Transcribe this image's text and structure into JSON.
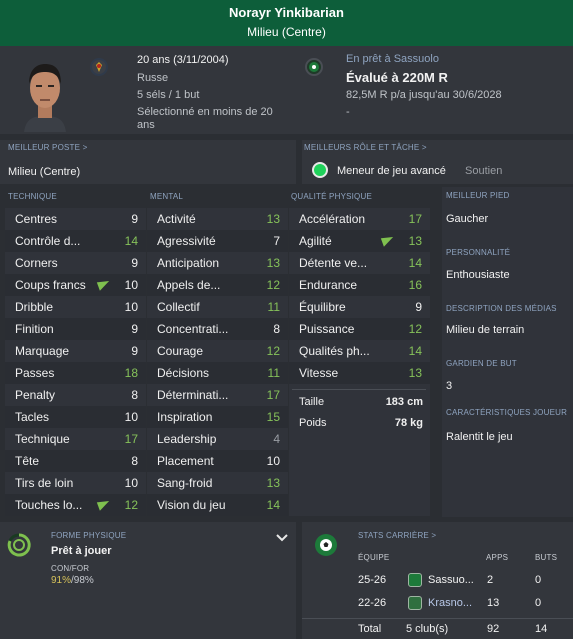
{
  "header": {
    "name": "Norayr Yinkibarian",
    "position": "Milieu (Centre)"
  },
  "profile": {
    "age": "20 ans (3/11/2004)",
    "nationality": "Russe",
    "caps": "5 séls / 1 but",
    "selected": "Sélectionné en moins de 20",
    "selected2": "ans"
  },
  "loan": {
    "status": "En prêt à Sassuolo",
    "value": "Évalué à 220M R",
    "wage": "82,5M R p/a jusqu'au 30/6/2028",
    "dash": "-"
  },
  "best_position": {
    "label": "MEILLEUR POSTE >",
    "value": "Milieu (Centre)"
  },
  "best_role": {
    "label": "MEILLEURS RÔLE ET TÂCHE >",
    "role": "Meneur de jeu avancé",
    "duty": "Soutien"
  },
  "sections": {
    "technique": "TECHNIQUE",
    "mental": "MENTAL",
    "physical": "QUALITÉ PHYSIQUE"
  },
  "technique": [
    {
      "name": "Centres",
      "value": "9"
    },
    {
      "name": "Contrôle d...",
      "value": "14"
    },
    {
      "name": "Corners",
      "value": "9"
    },
    {
      "name": "Coups francs",
      "value": "10"
    },
    {
      "name": "Dribble",
      "value": "10"
    },
    {
      "name": "Finition",
      "value": "9"
    },
    {
      "name": "Marquage",
      "value": "9"
    },
    {
      "name": "Passes",
      "value": "18"
    },
    {
      "name": "Penalty",
      "value": "8"
    },
    {
      "name": "Tacles",
      "value": "10"
    },
    {
      "name": "Technique",
      "value": "17"
    },
    {
      "name": "Tête",
      "value": "8"
    },
    {
      "name": "Tirs de loin",
      "value": "10"
    },
    {
      "name": "Touches lo...",
      "value": "12"
    }
  ],
  "mental": [
    {
      "name": "Activité",
      "value": "13"
    },
    {
      "name": "Agressivité",
      "value": "7"
    },
    {
      "name": "Anticipation",
      "value": "13"
    },
    {
      "name": "Appels de...",
      "value": "12"
    },
    {
      "name": "Collectif",
      "value": "11"
    },
    {
      "name": "Concentrati...",
      "value": "8"
    },
    {
      "name": "Courage",
      "value": "12"
    },
    {
      "name": "Décisions",
      "value": "11"
    },
    {
      "name": "Déterminati...",
      "value": "17"
    },
    {
      "name": "Inspiration",
      "value": "15"
    },
    {
      "name": "Leadership",
      "value": "4"
    },
    {
      "name": "Placement",
      "value": "10"
    },
    {
      "name": "Sang-froid",
      "value": "13"
    },
    {
      "name": "Vision du jeu",
      "value": "14"
    }
  ],
  "physical": [
    {
      "name": "Accélération",
      "value": "17"
    },
    {
      "name": "Agilité",
      "value": "13"
    },
    {
      "name": "Détente ve...",
      "value": "14"
    },
    {
      "name": "Endurance",
      "value": "16"
    },
    {
      "name": "Équilibre",
      "value": "9"
    },
    {
      "name": "Puissance",
      "value": "12"
    },
    {
      "name": "Qualités ph...",
      "value": "14"
    },
    {
      "name": "Vitesse",
      "value": "13"
    }
  ],
  "body": {
    "height_label": "Taille",
    "height": "183 cm",
    "weight_label": "Poids",
    "weight": "78 kg"
  },
  "side": {
    "foot_label": "MEILLEUR PIED",
    "foot": "Gaucher",
    "personality_label": "PERSONNALITÉ",
    "personality": "Enthousiaste",
    "media_label": "DESCRIPTION DES MÉDIAS",
    "media": "Milieu de terrain",
    "gk_label": "GARDIEN DE BUT",
    "gk": "3",
    "traits_label": "CARACTÉRISTIQUES JOUEUR",
    "traits": "Ralentit le jeu"
  },
  "fitness": {
    "label": "FORME PHYSIQUE",
    "status": "Prêt à jouer",
    "cf_label": "CON/FOR",
    "cf_green": "91%",
    "cf_rest": "/98%"
  },
  "career": {
    "label": "STATS CARRIÈRE >",
    "col_team": "ÉQUIPE",
    "col_apps": "APPS",
    "col_goals": "BUTS",
    "rows": [
      {
        "season": "25-26",
        "club": "Sassuo...",
        "apps": "2",
        "goals": "0"
      },
      {
        "season": "22-26",
        "club": "Krasno...",
        "apps": "13",
        "goals": "0"
      }
    ],
    "total_label": "Total",
    "total_clubs": "5 club(s)",
    "total_apps": "92",
    "total_goals": "14"
  },
  "colors": {
    "accent": "#0d5e3a",
    "good": "#86c25a",
    "link": "#8fa4c0"
  }
}
